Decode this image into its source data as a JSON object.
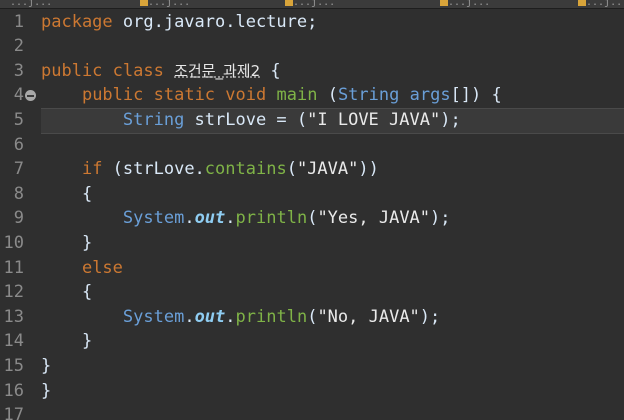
{
  "tabs": [
    {
      "label": "...j...",
      "has_icon": false
    },
    {
      "label": "...j...",
      "has_icon": true
    },
    {
      "label": "...j...",
      "has_icon": true
    },
    {
      "label": "...j...",
      "has_icon": true
    },
    {
      "label": "...j...",
      "has_icon": true
    }
  ],
  "colors": {
    "background": "#2f2f2f",
    "keyword": "#cc7832",
    "type": "#6a9fd8",
    "method_main": "#7fb347",
    "field": "#8fcdf2",
    "text": "#d9e8f7"
  },
  "editor": {
    "current_line": 5,
    "lines": [
      {
        "n": "1",
        "tokens": [
          {
            "t": "package",
            "c": "kw"
          },
          {
            "t": " org.javaro.lecture;",
            "c": "pl"
          }
        ]
      },
      {
        "n": "2",
        "tokens": []
      },
      {
        "n": "3",
        "tokens": [
          {
            "t": "public",
            "c": "kw"
          },
          {
            "t": " ",
            "c": "pl"
          },
          {
            "t": "class",
            "c": "kw"
          },
          {
            "t": " ",
            "c": "pl"
          },
          {
            "t": "조건문_과제2",
            "c": "kr"
          },
          {
            "t": " {",
            "c": "pl"
          }
        ]
      },
      {
        "n": "4",
        "marker": true,
        "tokens": [
          {
            "t": "    ",
            "c": "pl"
          },
          {
            "t": "public",
            "c": "kw"
          },
          {
            "t": " ",
            "c": "pl"
          },
          {
            "t": "static",
            "c": "kw"
          },
          {
            "t": " ",
            "c": "pl"
          },
          {
            "t": "void",
            "c": "kw"
          },
          {
            "t": " ",
            "c": "pl"
          },
          {
            "t": "main",
            "c": "main"
          },
          {
            "t": " (",
            "c": "pl"
          },
          {
            "t": "String",
            "c": "cls"
          },
          {
            "t": " ",
            "c": "pl"
          },
          {
            "t": "args",
            "c": "cls"
          },
          {
            "t": "[]) {",
            "c": "pl"
          }
        ]
      },
      {
        "n": "5",
        "tokens": [
          {
            "t": "        ",
            "c": "pl"
          },
          {
            "t": "String",
            "c": "cls"
          },
          {
            "t": " strLove = (",
            "c": "pl"
          },
          {
            "t": "\"I LOVE JAVA\"",
            "c": "str"
          },
          {
            "t": ");",
            "c": "pl"
          }
        ]
      },
      {
        "n": "6",
        "tokens": []
      },
      {
        "n": "7",
        "tokens": [
          {
            "t": "    ",
            "c": "pl"
          },
          {
            "t": "if",
            "c": "kw"
          },
          {
            "t": " (strLove.",
            "c": "pl"
          },
          {
            "t": "contains",
            "c": "main"
          },
          {
            "t": "(",
            "c": "pl"
          },
          {
            "t": "\"JAVA\"",
            "c": "str"
          },
          {
            "t": "))",
            "c": "pl"
          }
        ]
      },
      {
        "n": "8",
        "tokens": [
          {
            "t": "    {",
            "c": "pl"
          }
        ]
      },
      {
        "n": "9",
        "tokens": [
          {
            "t": "        ",
            "c": "pl"
          },
          {
            "t": "System",
            "c": "cls"
          },
          {
            "t": ".",
            "c": "pl"
          },
          {
            "t": "out",
            "c": "field"
          },
          {
            "t": ".",
            "c": "pl"
          },
          {
            "t": "println",
            "c": "main"
          },
          {
            "t": "(",
            "c": "pl"
          },
          {
            "t": "\"Yes, JAVA\"",
            "c": "str"
          },
          {
            "t": ");",
            "c": "pl"
          }
        ]
      },
      {
        "n": "10",
        "tokens": [
          {
            "t": "    }",
            "c": "pl"
          }
        ]
      },
      {
        "n": "11",
        "tokens": [
          {
            "t": "    ",
            "c": "pl"
          },
          {
            "t": "else",
            "c": "kw"
          }
        ]
      },
      {
        "n": "12",
        "tokens": [
          {
            "t": "    {",
            "c": "pl"
          }
        ]
      },
      {
        "n": "13",
        "tokens": [
          {
            "t": "        ",
            "c": "pl"
          },
          {
            "t": "System",
            "c": "cls"
          },
          {
            "t": ".",
            "c": "pl"
          },
          {
            "t": "out",
            "c": "field"
          },
          {
            "t": ".",
            "c": "pl"
          },
          {
            "t": "println",
            "c": "main"
          },
          {
            "t": "(",
            "c": "pl"
          },
          {
            "t": "\"No, JAVA\"",
            "c": "str"
          },
          {
            "t": ");",
            "c": "pl"
          }
        ]
      },
      {
        "n": "14",
        "tokens": [
          {
            "t": "    }",
            "c": "pl"
          }
        ]
      },
      {
        "n": "15",
        "tokens": [
          {
            "t": "}",
            "c": "pl"
          }
        ]
      },
      {
        "n": "16",
        "tokens": [
          {
            "t": "}",
            "c": "pl"
          }
        ]
      },
      {
        "n": "17",
        "tokens": []
      }
    ]
  }
}
